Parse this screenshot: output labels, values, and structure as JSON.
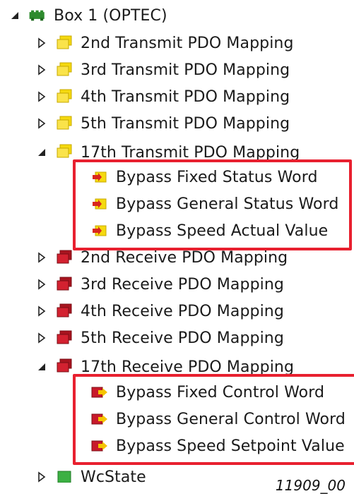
{
  "tree": {
    "root": {
      "label": "Box 1 (OPTEC)",
      "icon": "green-box-icon",
      "expanded": true
    },
    "items": [
      {
        "label": "2nd Transmit PDO Mapping",
        "icon": "yellow-transmit-pdo-icon",
        "expanded": false
      },
      {
        "label": "3rd Transmit PDO Mapping",
        "icon": "yellow-transmit-pdo-icon",
        "expanded": false
      },
      {
        "label": "4th Transmit PDO Mapping",
        "icon": "yellow-transmit-pdo-icon",
        "expanded": false
      },
      {
        "label": "5th Transmit PDO Mapping",
        "icon": "yellow-transmit-pdo-icon",
        "expanded": false
      },
      {
        "label": "17th Transmit PDO Mapping",
        "icon": "yellow-transmit-pdo-icon",
        "expanded": true,
        "children": [
          {
            "label": "Bypass Fixed Status Word",
            "icon": "input-variable-icon"
          },
          {
            "label": "Bypass General Status Word",
            "icon": "input-variable-icon"
          },
          {
            "label": "Bypass Speed Actual Value",
            "icon": "input-variable-icon"
          }
        ]
      },
      {
        "label": "2nd Receive PDO Mapping",
        "icon": "red-receive-pdo-icon",
        "expanded": false
      },
      {
        "label": "3rd Receive PDO Mapping",
        "icon": "red-receive-pdo-icon",
        "expanded": false
      },
      {
        "label": "4th Receive PDO Mapping",
        "icon": "red-receive-pdo-icon",
        "expanded": false
      },
      {
        "label": "5th Receive PDO Mapping",
        "icon": "red-receive-pdo-icon",
        "expanded": false
      },
      {
        "label": "17th Receive PDO Mapping",
        "icon": "red-receive-pdo-icon",
        "expanded": true,
        "children": [
          {
            "label": "Bypass Fixed Control Word",
            "icon": "output-variable-icon"
          },
          {
            "label": "Bypass General Control Word",
            "icon": "output-variable-icon"
          },
          {
            "label": "Bypass Speed Setpoint Value",
            "icon": "output-variable-icon"
          }
        ]
      },
      {
        "label": "WcState",
        "icon": "green-wcstate-icon",
        "expanded": false
      }
    ]
  },
  "figure_id": "11909_00",
  "colors": {
    "highlight_border": "#e8202f",
    "transmit_yellow": "#f5d90f",
    "receive_red": "#c8192a",
    "box_green": "#2e8b2e",
    "toggle": "#222222"
  }
}
